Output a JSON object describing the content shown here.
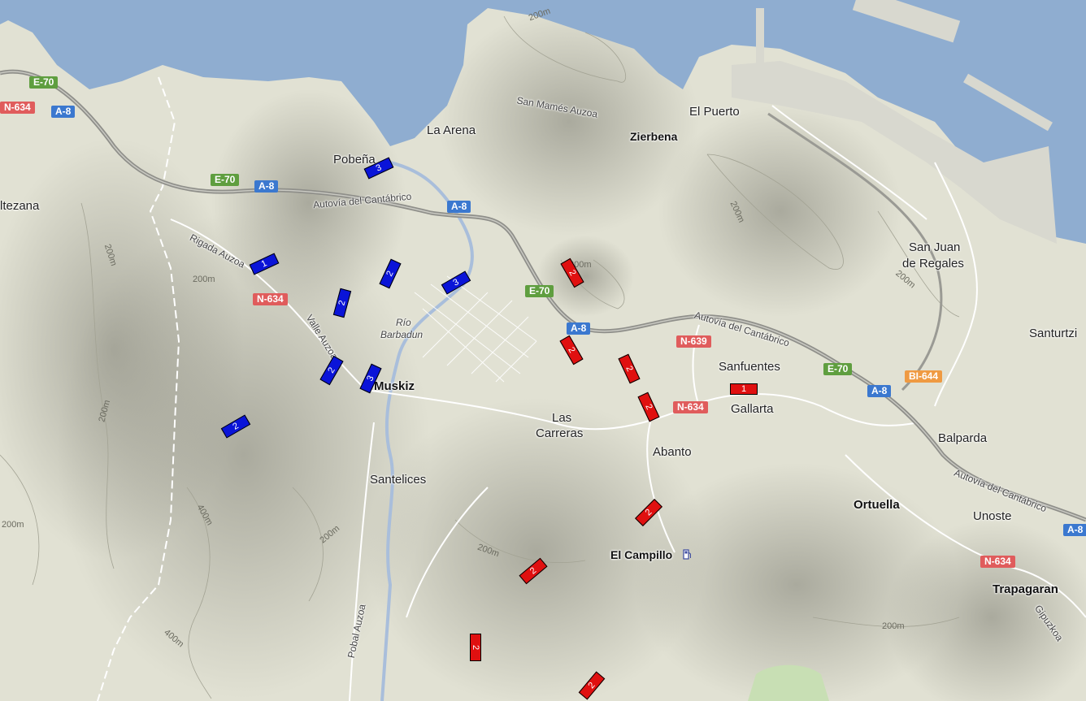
{
  "colors": {
    "sea": "#8fadd0",
    "land": "#e1e1d3",
    "highway": "#8f8f8a",
    "european_shield": "#5f9e3f",
    "motorway_shield": "#3b78cf",
    "national_shield": "#e05c5c",
    "regional_shield": "#ef9a42",
    "marker_blue": "#0a14d8",
    "marker_red": "#e01010"
  },
  "places": {
    "altezana": "ltezana",
    "pobena": "Pobeña",
    "la_arena": "La Arena",
    "san_mames": "San Mamés Auzoa",
    "zierbena": "Zierbena",
    "el_puerto": "El Puerto",
    "san_juan_1": "San Juan",
    "san_juan_2": "de Regales",
    "santurtzi": "Santurtzi",
    "rigada": "Rigada Auzoa",
    "valle": "Valle Auzoa",
    "rio_1": "Río",
    "rio_2": "Barbadun",
    "muskiz": "Muskiz",
    "sanfuentes": "Sanfuentes",
    "gallarta": "Gallarta",
    "las_carreras_1": "Las",
    "las_carreras_2": "Carreras",
    "abanto": "Abanto",
    "balparda": "Balparda",
    "santelices": "Santelices",
    "ortuella": "Ortuella",
    "unoste": "Unoste",
    "el_campillo": "El Campillo",
    "trapagaran": "Trapagaran",
    "gipuzkoa": "Gipuzkoa",
    "pobal": "Pobal Auzoa",
    "autovia_1": "Autovía del Cantábrico",
    "autovia_2": "Autovía del Cantábrico",
    "autovia_3": "Autovía del Cantábrico"
  },
  "contours": {
    "c1": "200m",
    "c2": "200m",
    "c3": "200m",
    "c4": "200m",
    "c5": "200m",
    "c6": "200m",
    "c7": "200m",
    "c8": "200m",
    "c9": "200m",
    "c10": "200m",
    "c11": "400m",
    "c12": "400m",
    "c13": "200m"
  },
  "road_shields": {
    "e70_a": "E-70",
    "n634_a": "N-634",
    "a8_a": "A-8",
    "e70_b": "E-70",
    "a8_b": "A-8",
    "a8_c": "A-8",
    "n634_b": "N-634",
    "e70_c": "E-70",
    "a8_d": "A-8",
    "n639": "N-639",
    "n634_c": "N-634",
    "e70_d": "E-70",
    "a8_e": "A-8",
    "bi644": "BI-644",
    "a8_f": "A-8",
    "n634_d": "N-634"
  },
  "markers": {
    "b1": "3",
    "b2": "1",
    "b3": "2",
    "b4": "3",
    "b5": "2",
    "b6": "2",
    "b7": "3",
    "b8": "2",
    "r1": "2",
    "r2": "2",
    "r3": "2",
    "r4": "2",
    "r5": "1",
    "r6": "2",
    "r7": "2",
    "r8": "2",
    "r9": "2"
  },
  "icons": {
    "fuel": "fuel-station-icon"
  }
}
